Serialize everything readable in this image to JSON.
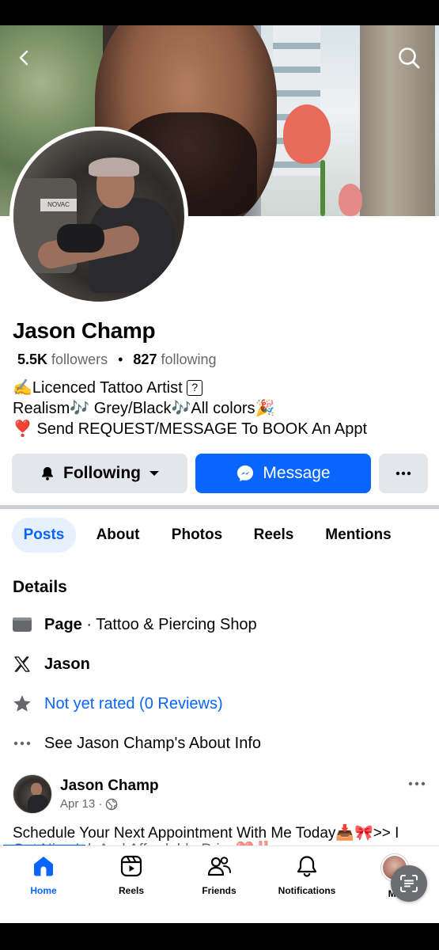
{
  "profile": {
    "name": "Jason Champ",
    "followers_count": "5.5K",
    "followers_label": "followers",
    "following_count": "827",
    "following_label": "following",
    "bio": [
      "✍️Licenced Tattoo Artist",
      "Realism🎶 Grey/Black🎶All colors🎉",
      "❣️ Send REQUEST/MESSAGE To BOOK An Appt"
    ]
  },
  "actions": {
    "following_label": "Following",
    "message_label": "Message"
  },
  "tabs": [
    "Posts",
    "About",
    "Photos",
    "Reels",
    "Mentions"
  ],
  "details": {
    "title": "Details",
    "page_label": "Page",
    "page_category": " · Tattoo & Piercing Shop",
    "x_handle": "Jason",
    "rating": "Not yet rated (0 Reviews)",
    "about_link": "See Jason Champ's About Info"
  },
  "post": {
    "author": "Jason Champ",
    "date": "Apr 13 ·",
    "text": "Schedule Your Next Appointment With Me Today📥🎀>> I",
    "text_cut": "Get Nice Ink And Affordable Price❤️‼️"
  },
  "nav": {
    "items": [
      "Home",
      "Reels",
      "Friends",
      "Notifications",
      "Me"
    ]
  },
  "colors": {
    "brand_blue": "#0866ff",
    "button_grey": "#e4e6eb",
    "muted_text": "#65676b"
  }
}
